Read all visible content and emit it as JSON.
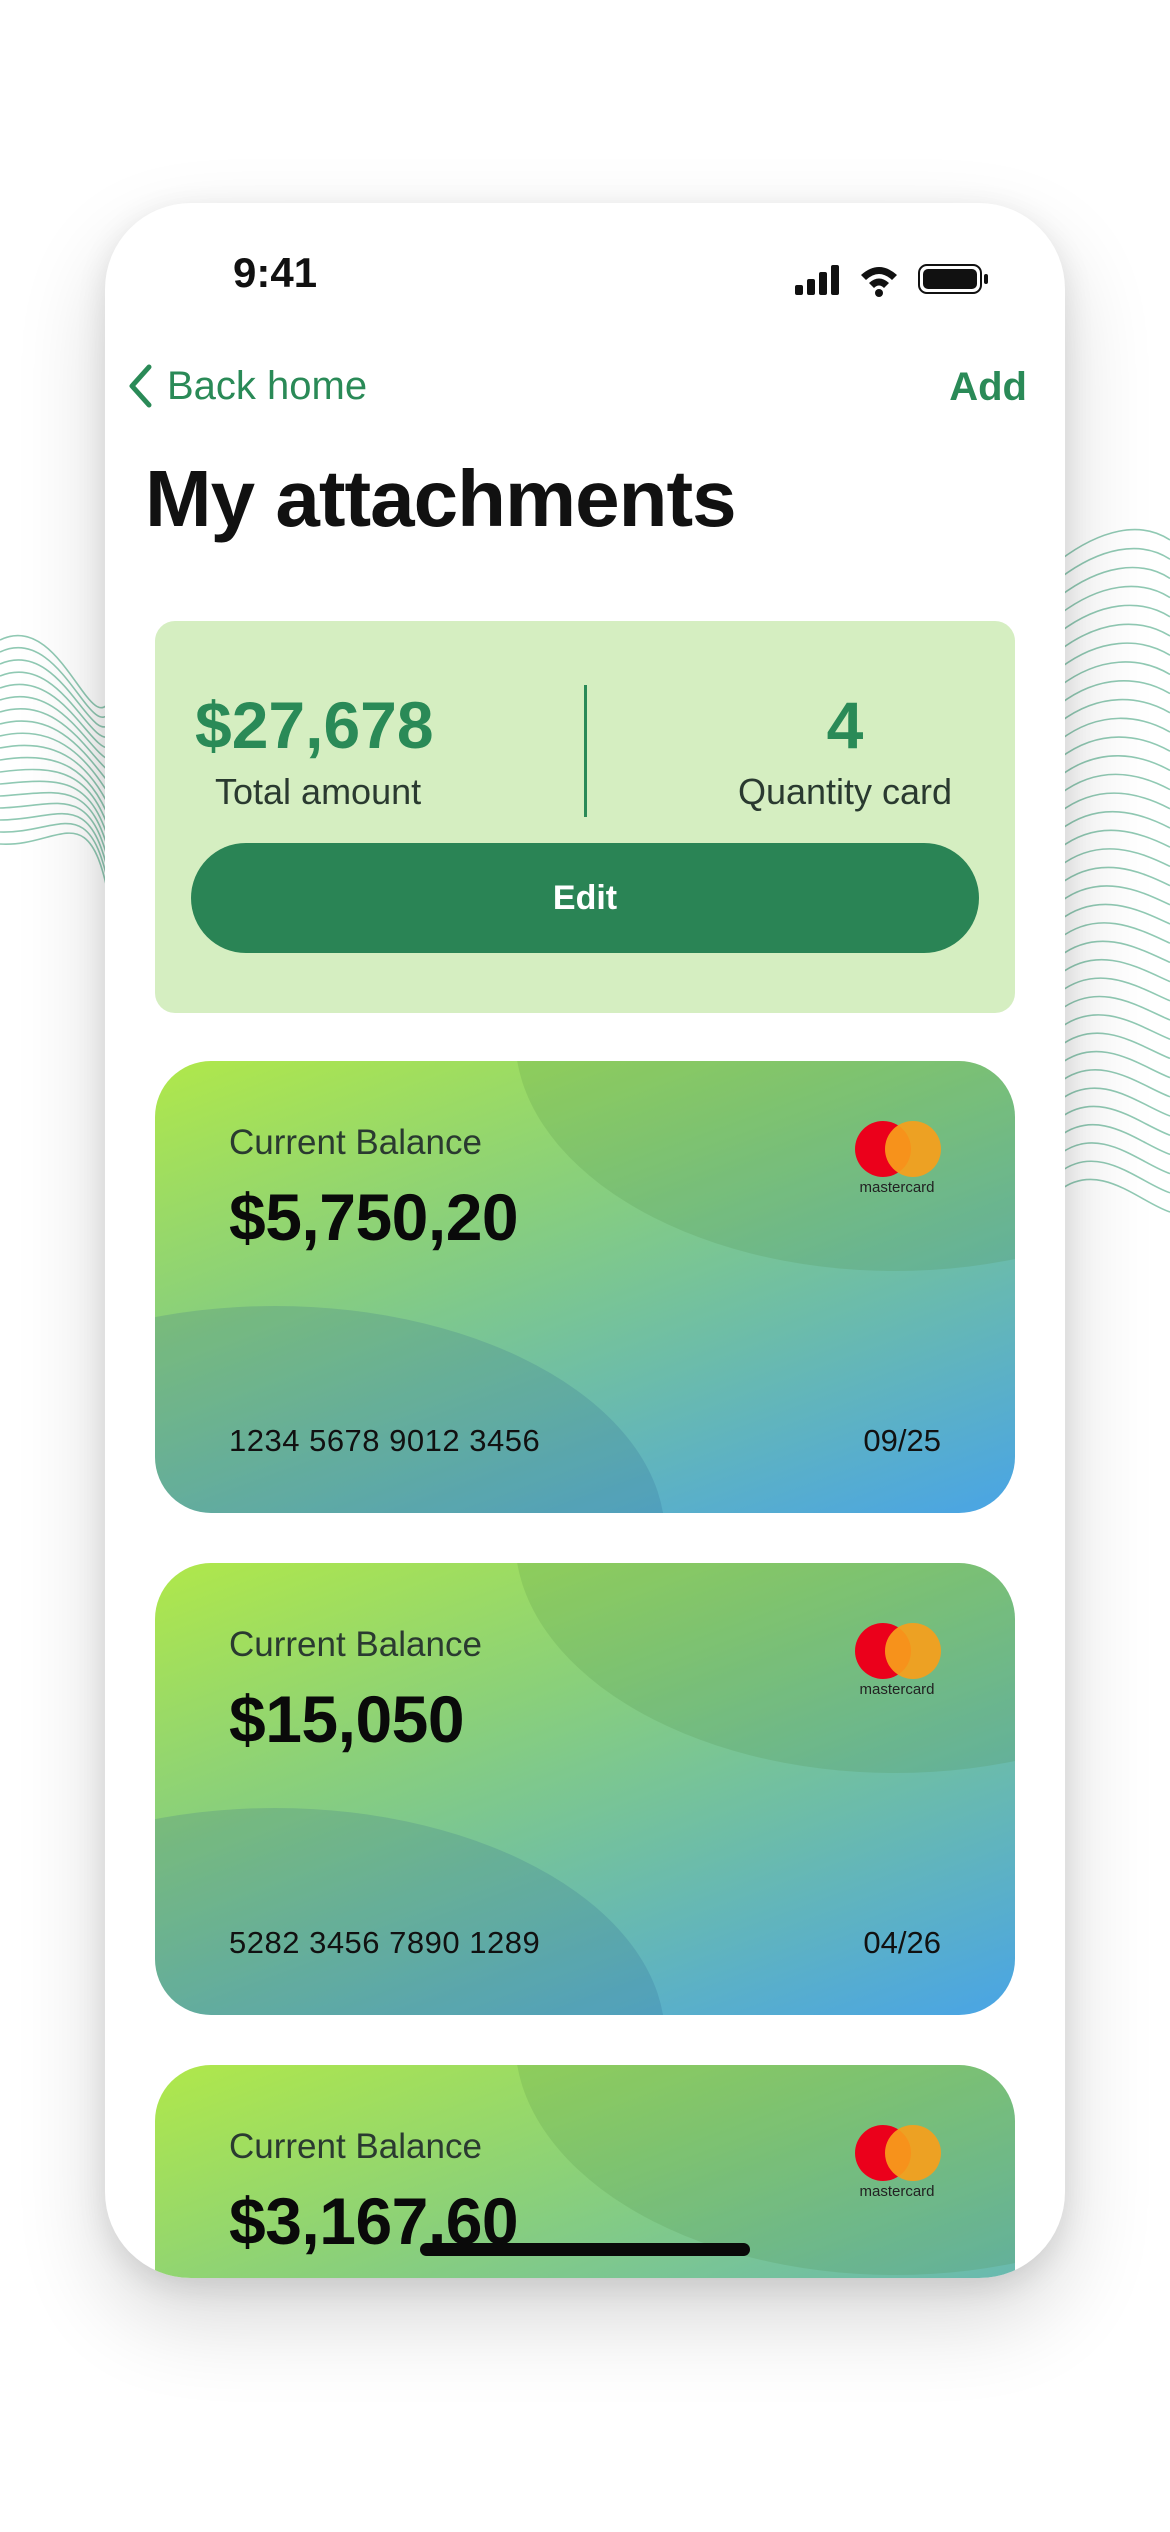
{
  "status_bar": {
    "time": "9:41"
  },
  "nav": {
    "back_label": "Back home",
    "add_label": "Add"
  },
  "page": {
    "title": "My attachments"
  },
  "summary": {
    "total_amount": "$27,678",
    "total_amount_label": "Total amount",
    "quantity": "4",
    "quantity_label": "Quantity card",
    "edit_label": "Edit"
  },
  "cards": [
    {
      "label": "Current Balance",
      "balance": "$5,750,20",
      "number": "1234 5678 9012 3456",
      "expiry": "09/25",
      "brand": "mastercard"
    },
    {
      "label": "Current Balance",
      "balance": "$15,050",
      "number": "5282 3456 7890 1289",
      "expiry": "04/26",
      "brand": "mastercard"
    },
    {
      "label": "Current Balance",
      "balance": "$3,167,60",
      "brand": "mastercard"
    }
  ],
  "colors": {
    "accent": "#2a8a57",
    "summary_bg": "#d5eec1",
    "button": "#2a8455"
  }
}
